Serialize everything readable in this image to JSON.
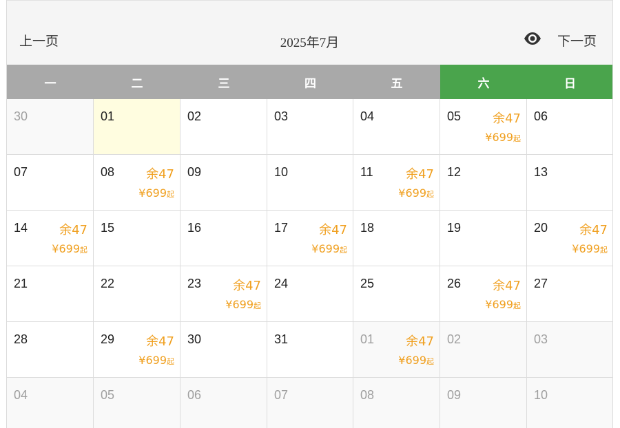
{
  "header": {
    "prev_label": "上一页",
    "title": "2025年7月",
    "next_label": "下一页",
    "view_icon": "eye-icon"
  },
  "weekdays": [
    {
      "label": "一",
      "weekend": false
    },
    {
      "label": "二",
      "weekend": false
    },
    {
      "label": "三",
      "weekend": false
    },
    {
      "label": "四",
      "weekend": false
    },
    {
      "label": "五",
      "weekend": false
    },
    {
      "label": "六",
      "weekend": true
    },
    {
      "label": "日",
      "weekend": true
    }
  ],
  "colors": {
    "weekday_header": "#a9a9a9",
    "weekend_header": "#4aa44c",
    "accent": "#f0a020",
    "today_bg": "#fffde0",
    "other_month_text": "#a0a0a0"
  },
  "price_suffix": "起",
  "days": [
    {
      "day": "30",
      "other": true
    },
    {
      "day": "01",
      "today": true
    },
    {
      "day": "02"
    },
    {
      "day": "03"
    },
    {
      "day": "04"
    },
    {
      "day": "05",
      "stock": "余47",
      "price": "¥699"
    },
    {
      "day": "06"
    },
    {
      "day": "07"
    },
    {
      "day": "08",
      "stock": "余47",
      "price": "¥699"
    },
    {
      "day": "09"
    },
    {
      "day": "10"
    },
    {
      "day": "11",
      "stock": "余47",
      "price": "¥699"
    },
    {
      "day": "12"
    },
    {
      "day": "13"
    },
    {
      "day": "14",
      "stock": "余47",
      "price": "¥699"
    },
    {
      "day": "15"
    },
    {
      "day": "16"
    },
    {
      "day": "17",
      "stock": "余47",
      "price": "¥699"
    },
    {
      "day": "18"
    },
    {
      "day": "19"
    },
    {
      "day": "20",
      "stock": "余47",
      "price": "¥699"
    },
    {
      "day": "21"
    },
    {
      "day": "22"
    },
    {
      "day": "23",
      "stock": "余47",
      "price": "¥699"
    },
    {
      "day": "24"
    },
    {
      "day": "25"
    },
    {
      "day": "26",
      "stock": "余47",
      "price": "¥699"
    },
    {
      "day": "27"
    },
    {
      "day": "28"
    },
    {
      "day": "29",
      "stock": "余47",
      "price": "¥699"
    },
    {
      "day": "30"
    },
    {
      "day": "31"
    },
    {
      "day": "01",
      "other": true,
      "stock": "余47",
      "price": "¥699"
    },
    {
      "day": "02",
      "other": true
    },
    {
      "day": "03",
      "other": true
    },
    {
      "day": "04",
      "other": true
    },
    {
      "day": "05",
      "other": true
    },
    {
      "day": "06",
      "other": true
    },
    {
      "day": "07",
      "other": true
    },
    {
      "day": "08",
      "other": true
    },
    {
      "day": "09",
      "other": true
    },
    {
      "day": "10",
      "other": true
    }
  ]
}
